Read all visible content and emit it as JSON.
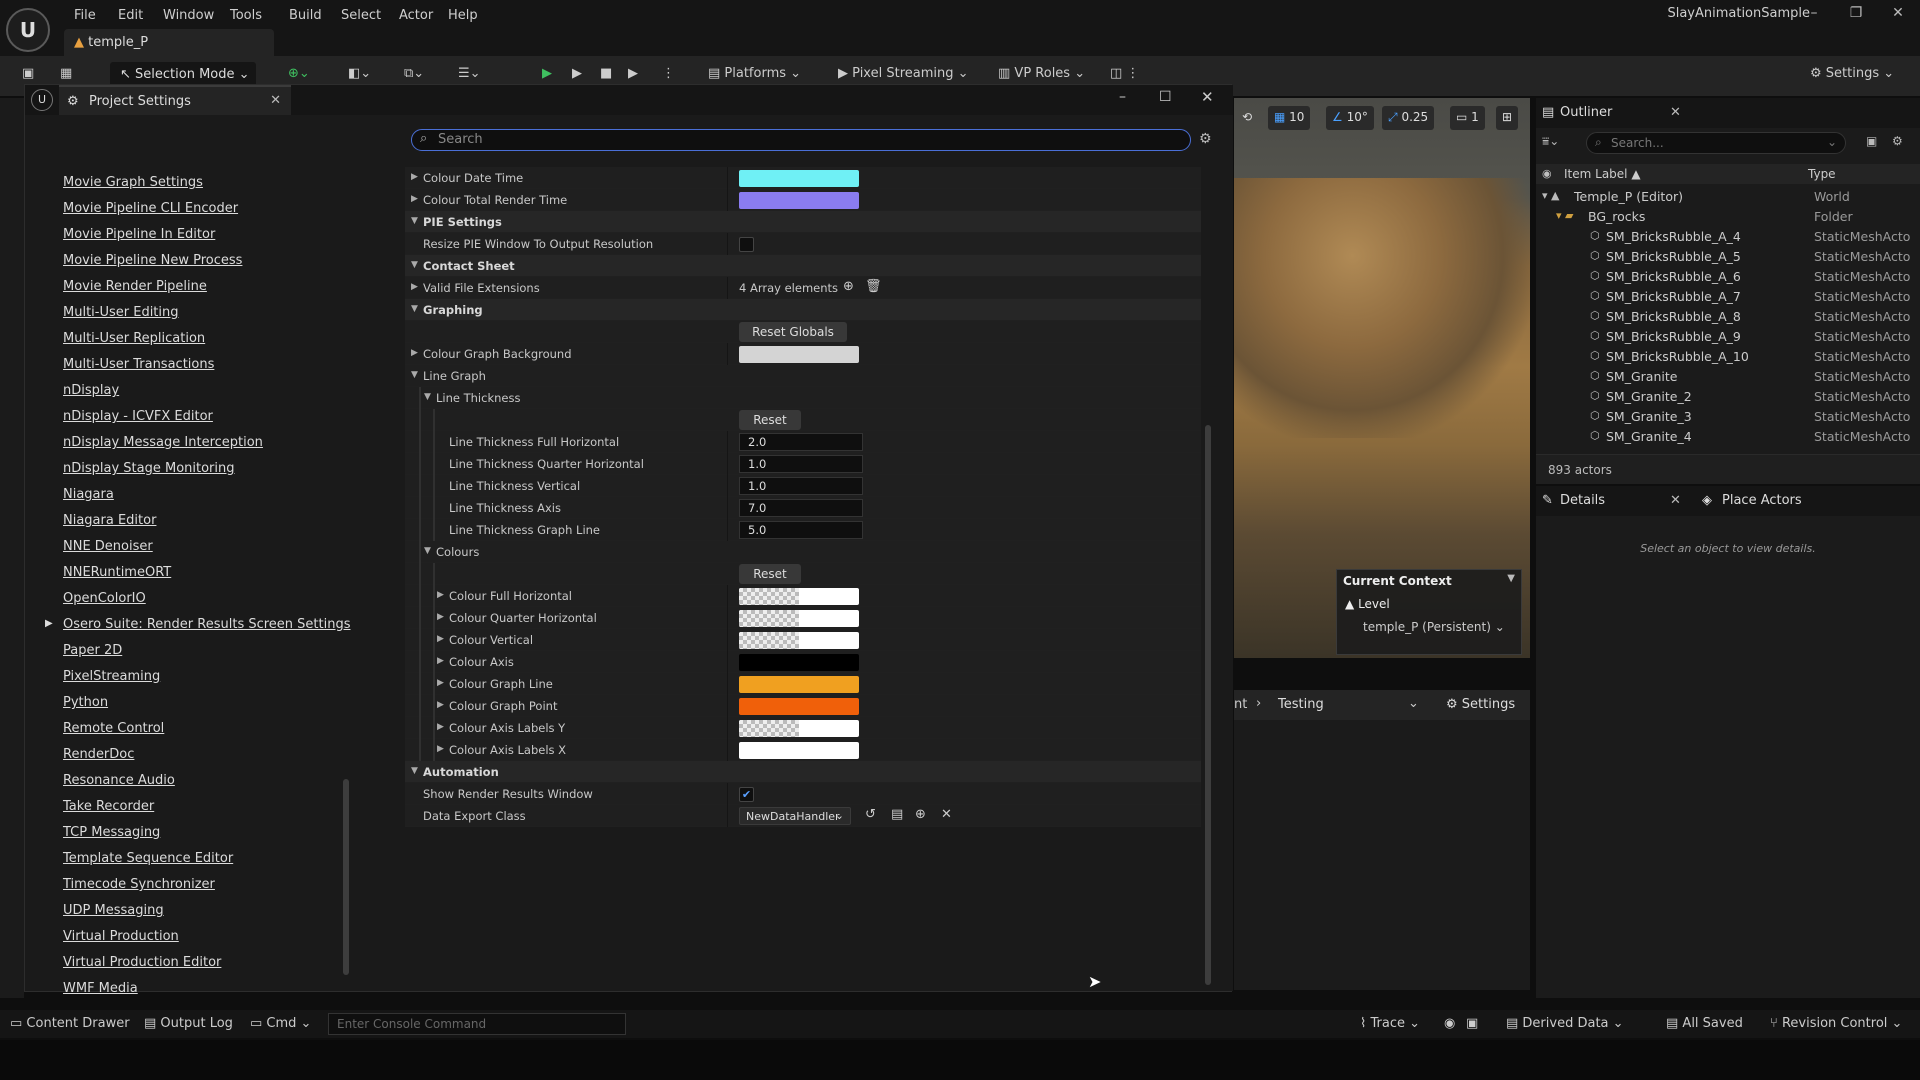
{
  "menubar": {
    "items": [
      "File",
      "Edit",
      "Window",
      "Tools",
      "Build",
      "Select",
      "Actor",
      "Help"
    ],
    "level_tab": "temple_P",
    "project_name": "SlayAnimationSample"
  },
  "toolbar": {
    "selection_mode": "Selection Mode",
    "platforms": "Platforms",
    "pixel_streaming": "Pixel Streaming",
    "vp_roles": "VP Roles",
    "settings": "Settings"
  },
  "viewport": {
    "grid_snap": "10",
    "rotation_snap": "10°",
    "scale_snap": "0.25",
    "camera_speed": "1",
    "context": {
      "title": "Current Context",
      "level_label": "Level",
      "level_value": "temple_P (Persistent)"
    },
    "bottom_bar": {
      "breadcrumb_fragment": "nt",
      "testing": "Testing",
      "settings": "Settings"
    }
  },
  "outliner": {
    "title": "Outliner",
    "search_placeholder": "Search...",
    "col_label": "Item Label ▲",
    "col_type": "Type",
    "rows": [
      {
        "label": "Temple_P (Editor)",
        "type": "World"
      },
      {
        "label": "BG_rocks",
        "type": "Folder"
      },
      {
        "label": "SM_BricksRubble_A_4",
        "type": "StaticMeshActo"
      },
      {
        "label": "SM_BricksRubble_A_5",
        "type": "StaticMeshActo"
      },
      {
        "label": "SM_BricksRubble_A_6",
        "type": "StaticMeshActo"
      },
      {
        "label": "SM_BricksRubble_A_7",
        "type": "StaticMeshActo"
      },
      {
        "label": "SM_BricksRubble_A_8",
        "type": "StaticMeshActo"
      },
      {
        "label": "SM_BricksRubble_A_9",
        "type": "StaticMeshActo"
      },
      {
        "label": "SM_BricksRubble_A_10",
        "type": "StaticMeshActo"
      },
      {
        "label": "SM_Granite",
        "type": "StaticMeshActo"
      },
      {
        "label": "SM_Granite_2",
        "type": "StaticMeshActo"
      },
      {
        "label": "SM_Granite_3",
        "type": "StaticMeshActo"
      },
      {
        "label": "SM_Granite_4",
        "type": "StaticMeshActo"
      }
    ],
    "actor_count": "893 actors"
  },
  "details": {
    "title": "Details",
    "place_actors": "Place Actors",
    "empty_text": "Select an object to view details."
  },
  "project_settings": {
    "title": "Project Settings",
    "search_placeholder": "Search",
    "sidebar": [
      "Movie Graph Settings",
      "Movie Pipeline CLI Encoder",
      "Movie Pipeline In Editor",
      "Movie Pipeline New Process",
      "Movie Render Pipeline",
      "Multi-User Editing",
      "Multi-User Replication",
      "Multi-User Transactions",
      "nDisplay",
      "nDisplay - ICVFX Editor",
      "nDisplay Message Interception",
      "nDisplay Stage Monitoring",
      "Niagara",
      "Niagara Editor",
      "NNE Denoiser",
      "NNERuntimeORT",
      "OpenColorIO",
      "Osero Suite: Render Results Screen Settings",
      "Paper 2D",
      "PixelStreaming",
      "Python",
      "Remote Control",
      "RenderDoc",
      "Resonance Audio",
      "Take Recorder",
      "TCP Messaging",
      "Template Sequence Editor",
      "Timecode Synchronizer",
      "UDP Messaging",
      "Virtual Production",
      "Virtual Production Editor",
      "WMF Media"
    ],
    "props": {
      "colour_date_time": "Colour Date Time",
      "colour_total_render_time": "Colour Total Render Time",
      "pie_settings": "PIE Settings",
      "resize_pie": "Resize PIE Window To Output Resolution",
      "contact_sheet": "Contact Sheet",
      "valid_file_ext": "Valid File Extensions",
      "array_elements": "4 Array elements",
      "graphing": "Graphing",
      "reset_globals": "Reset Globals",
      "colour_graph_bg": "Colour Graph Background",
      "line_graph": "Line Graph",
      "line_thickness": "Line Thickness",
      "reset": "Reset",
      "lt_full_h": "Line Thickness Full Horizontal",
      "lt_full_h_val": "2.0",
      "lt_quarter_h": "Line Thickness Quarter Horizontal",
      "lt_quarter_h_val": "1.0",
      "lt_vertical": "Line Thickness Vertical",
      "lt_vertical_val": "1.0",
      "lt_axis": "Line Thickness Axis",
      "lt_axis_val": "7.0",
      "lt_graph_line": "Line Thickness Graph Line",
      "lt_graph_line_val": "5.0",
      "colours": "Colours",
      "c_full_h": "Colour Full Horizontal",
      "c_quarter_h": "Colour Quarter Horizontal",
      "c_vertical": "Colour Vertical",
      "c_axis": "Colour Axis",
      "c_graph_line": "Colour Graph Line",
      "c_graph_point": "Colour Graph Point",
      "c_axis_labels_y": "Colour Axis Labels Y",
      "c_axis_labels_x": "Colour Axis Labels X",
      "automation": "Automation",
      "show_render_results": "Show Render Results Window",
      "data_export_class": "Data Export Class",
      "data_export_value": "NewDataHandler"
    },
    "colors": {
      "date_time": "#6ff0f5",
      "total_render_time": "#8a7cf0",
      "graph_bg": "#d4d4d4",
      "axis": "#000000",
      "graph_line": "#f0a020",
      "graph_point": "#f0600a",
      "axis_labels_x": "#ffffff"
    }
  },
  "statusbar": {
    "content_drawer": "Content Drawer",
    "output_log": "Output Log",
    "cmd": "Cmd",
    "console_placeholder": "Enter Console Command",
    "trace": "Trace",
    "derived_data": "Derived Data",
    "all_saved": "All Saved",
    "revision_control": "Revision Control"
  }
}
